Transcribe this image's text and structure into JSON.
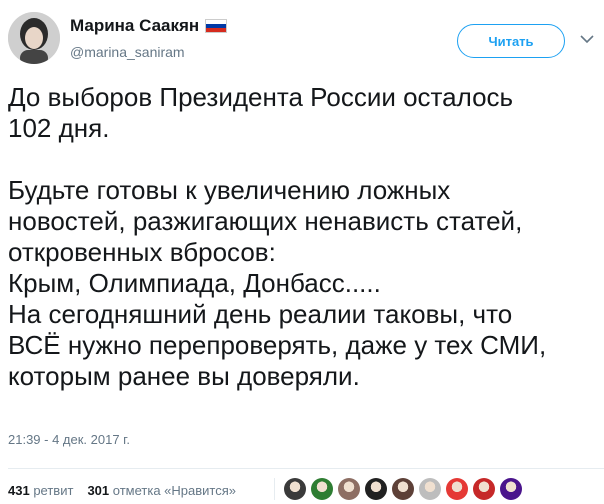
{
  "author": {
    "name": "Марина Саакян",
    "handle": "@marina_saniram"
  },
  "follow_button": {
    "label": "Читать"
  },
  "tweet": {
    "text": "До выборов Президента России осталось\n102 дня.\n\nБудьте готовы к увеличению ложных\nновостей, разжигающих ненависть статей,\nоткровенных вбросов:\nКрым, Олимпиада, Донбасс.....\nНа сегодняшний день реалии таковы, что\nВСЁ нужно перепроверять, даже у тех СМИ,\nкоторым ранее вы доверяли.",
    "timestamp": "21:39 - 4 дек. 2017 г."
  },
  "stats": {
    "retweets_count": "431",
    "retweets_label": "ретвит",
    "likes_count": "301",
    "likes_label": "отметка «Нравится»"
  },
  "colors": {
    "accent": "#1da1f2",
    "secondary_text": "#657786"
  },
  "likers": [
    {
      "icon": "liker-avatar-1",
      "color": "#3a3a3a"
    },
    {
      "icon": "liker-avatar-2",
      "color": "#2e7d32"
    },
    {
      "icon": "liker-avatar-3",
      "color": "#8d6e63"
    },
    {
      "icon": "liker-avatar-4",
      "color": "#212121"
    },
    {
      "icon": "liker-avatar-5",
      "color": "#5d4037"
    },
    {
      "icon": "liker-avatar-6",
      "color": "#bdbdbd"
    },
    {
      "icon": "liker-avatar-7",
      "color": "#e53935"
    },
    {
      "icon": "liker-avatar-8",
      "color": "#c62828"
    },
    {
      "icon": "liker-avatar-9",
      "color": "#4a148c"
    }
  ]
}
